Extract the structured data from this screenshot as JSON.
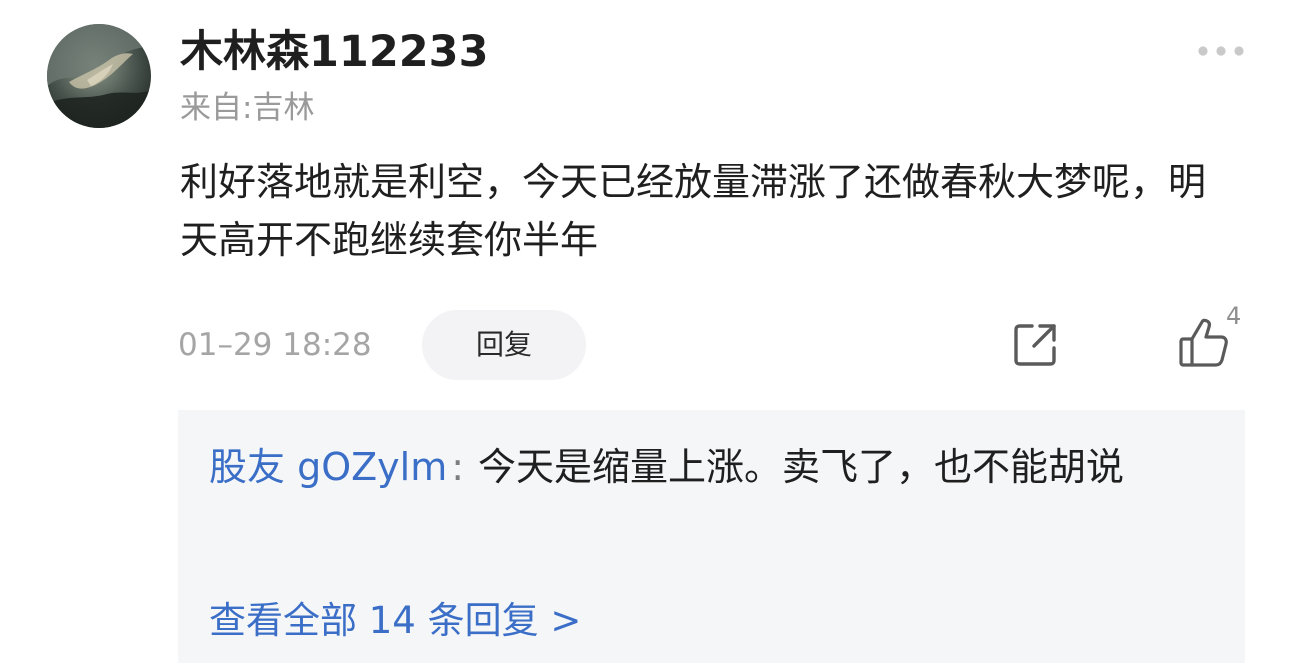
{
  "comment": {
    "username": "木林森112233",
    "location": "来自:吉林",
    "content": "利好落地就是利空，今天已经放量滞涨了还做春秋大梦呢，明天高开不跑继续套你半年",
    "timestamp": "01–29 18:28",
    "reply_label": "回复",
    "like_count": "4"
  },
  "replies": {
    "first_reply": {
      "author": "股友 gOZylm",
      "separator": ":",
      "text": "今天是缩量上涨。卖飞了，也不能胡说"
    },
    "view_all_label": "查看全部 14 条回复 >"
  },
  "icons": {
    "more": "more-icon",
    "share": "share-icon",
    "like": "like-icon"
  },
  "colors": {
    "accent_blue": "#3a6ec7",
    "muted_gray": "#9a9a9a",
    "reply_box_bg": "#f5f6f8",
    "reply_button_bg": "#f3f3f5"
  }
}
